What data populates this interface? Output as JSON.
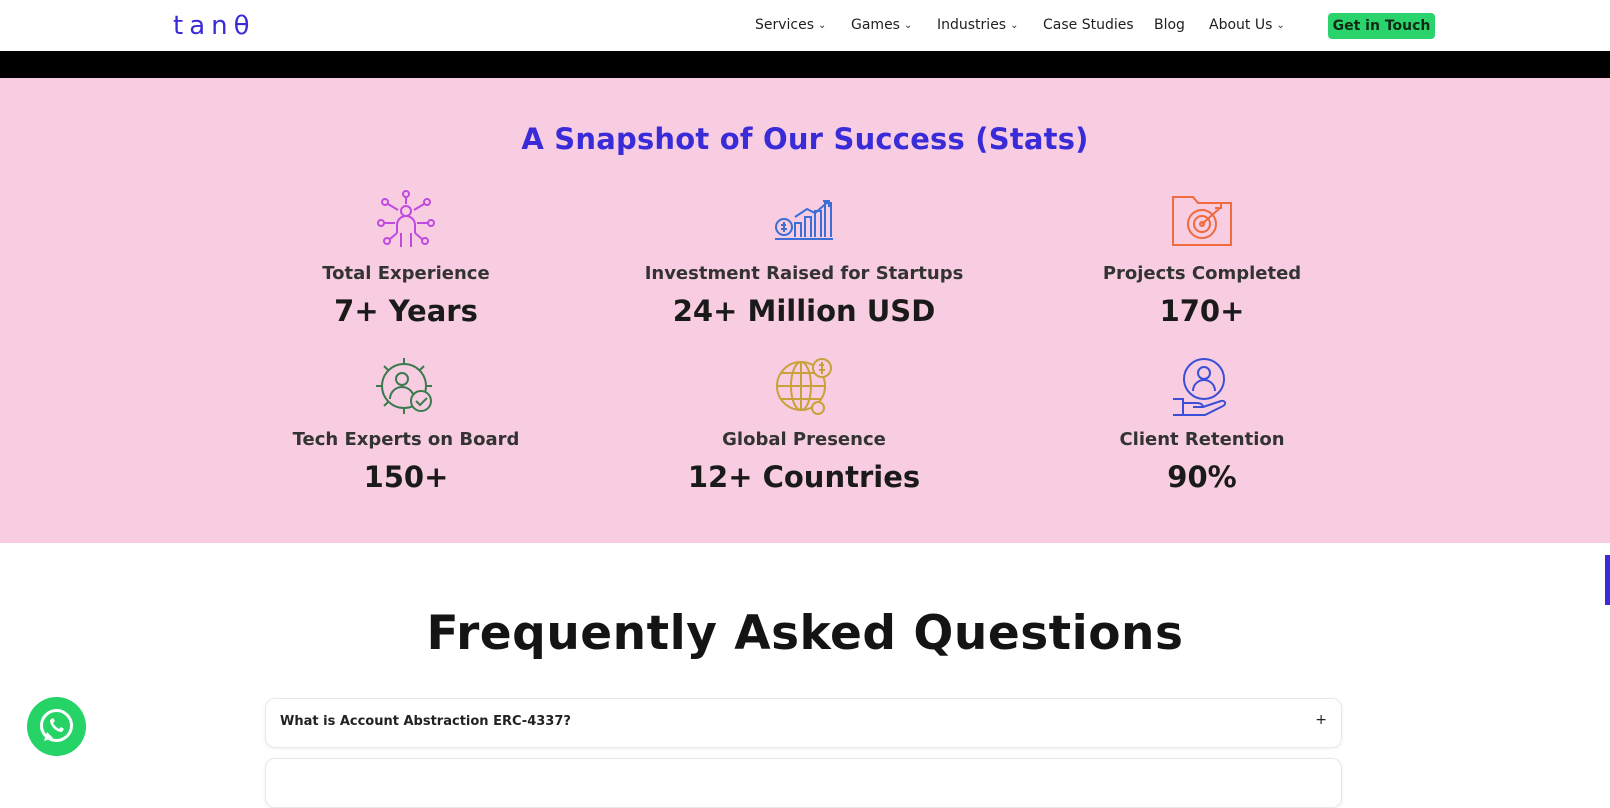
{
  "brand": {
    "logo_text": "tanθ",
    "logo_color": "#3a2bd8"
  },
  "nav": {
    "items": [
      {
        "label": "Services",
        "dropdown": true
      },
      {
        "label": "Games",
        "dropdown": true
      },
      {
        "label": "Industries",
        "dropdown": true
      },
      {
        "label": "Case Studies",
        "dropdown": false
      },
      {
        "label": "Blog",
        "dropdown": false
      },
      {
        "label": "About Us",
        "dropdown": true
      }
    ],
    "cta_label": "Get in Touch",
    "cta_color": "#2ad36b"
  },
  "stats": {
    "title": "A Snapshot of Our Success (Stats)",
    "background": "#f8cde2",
    "items": [
      {
        "label": "Total Experience",
        "value": "7+ Years",
        "icon": "team-network-icon",
        "icon_color": "#c04adf"
      },
      {
        "label": "Investment Raised for Startups",
        "value": "24+ Million USD",
        "icon": "growth-chart-icon",
        "icon_color": "#3b6fd6"
      },
      {
        "label": "Projects Completed",
        "value": "170+",
        "icon": "target-folder-icon",
        "icon_color": "#ef6a3c"
      },
      {
        "label": "Tech Experts on Board",
        "value": "150+",
        "icon": "expert-gear-icon",
        "icon_color": "#3a7a4e"
      },
      {
        "label": "Global Presence",
        "value": "12+ Countries",
        "icon": "globe-dollar-icon",
        "icon_color": "#c9a13b"
      },
      {
        "label": "Client Retention",
        "value": "90%",
        "icon": "client-hand-icon",
        "icon_color": "#3b4fd6"
      }
    ]
  },
  "faq": {
    "title": "Frequently Asked Questions",
    "items": [
      {
        "question": "What is Account Abstraction ERC-4337?",
        "toggle": "+"
      },
      {
        "question": "",
        "toggle": ""
      }
    ]
  }
}
